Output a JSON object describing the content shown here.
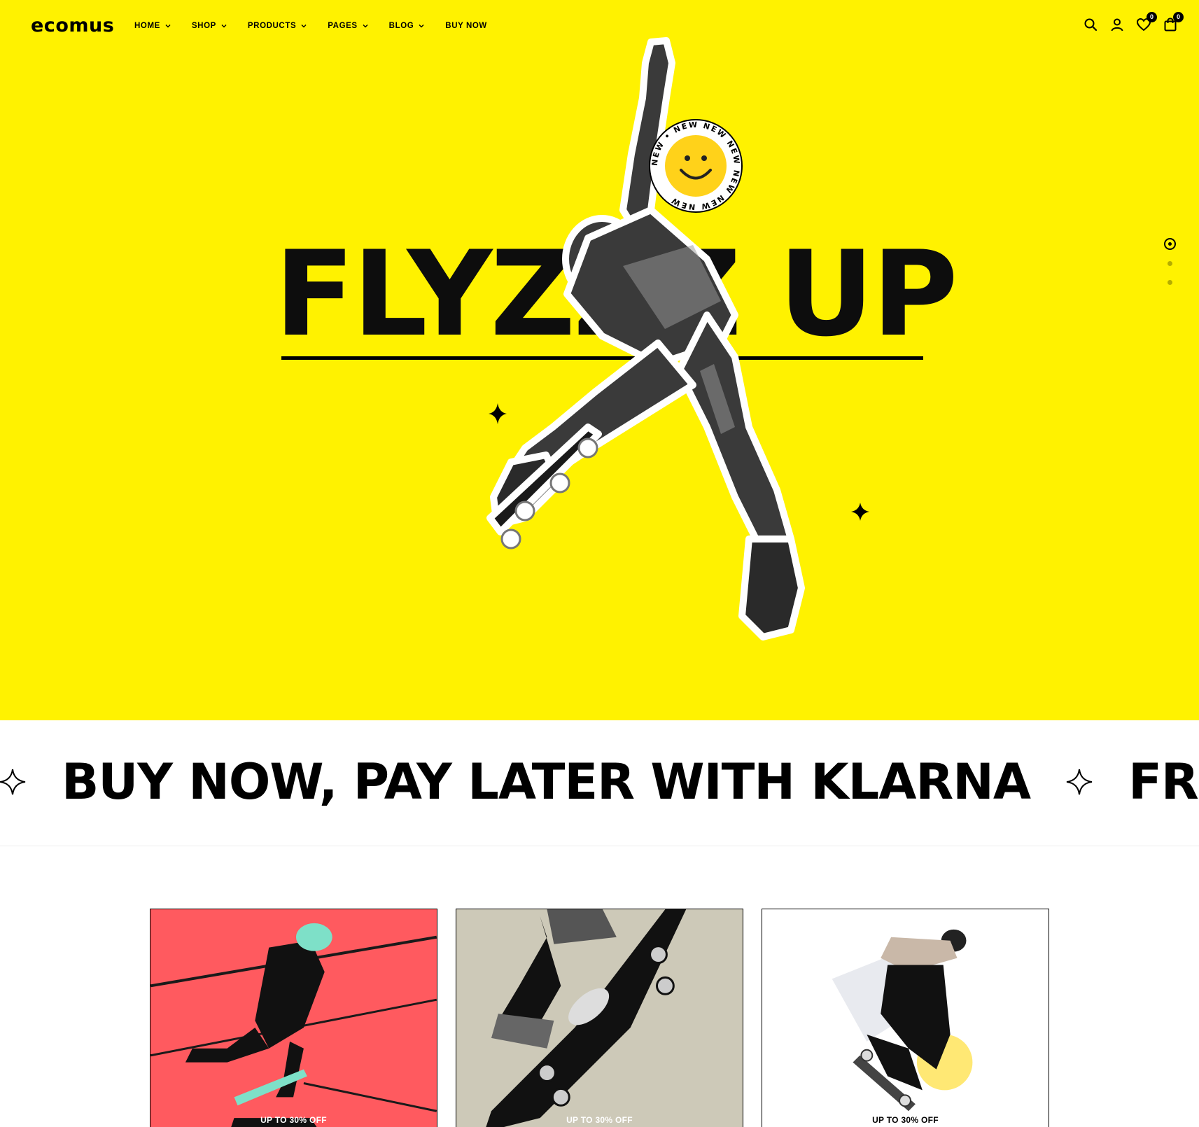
{
  "brand": {
    "logo": "ecomus",
    "accent": "#fff200"
  },
  "nav": [
    {
      "label": "HOME",
      "has_dropdown": true
    },
    {
      "label": "SHOP",
      "has_dropdown": true
    },
    {
      "label": "PRODUCTS",
      "has_dropdown": true
    },
    {
      "label": "PAGES",
      "has_dropdown": true
    },
    {
      "label": "BLOG",
      "has_dropdown": true
    },
    {
      "label": "BUY NOW",
      "has_dropdown": false
    }
  ],
  "header_icons": {
    "search": "search-icon",
    "account": "user-icon",
    "wishlist": {
      "icon": "heart-icon",
      "count": "0"
    },
    "cart": {
      "icon": "cart-icon",
      "count": "0"
    }
  },
  "hero": {
    "title": "FLYZZZ UP",
    "sticker_text": "NEW • NEW NEW NEW NEW NEW NEW",
    "slides_total": 3,
    "active_slide": 1
  },
  "marquee": {
    "items": [
      "BUY NOW, PAY LATER WITH KLARNA",
      "FREE"
    ]
  },
  "cards": [
    {
      "badge": "UP TO 30% OFF",
      "bg": "#ff5a5f"
    },
    {
      "badge": "UP TO 30% OFF",
      "bg": "#cdc9b8"
    },
    {
      "badge": "UP TO 30% OFF",
      "bg": "#ffffff"
    }
  ]
}
